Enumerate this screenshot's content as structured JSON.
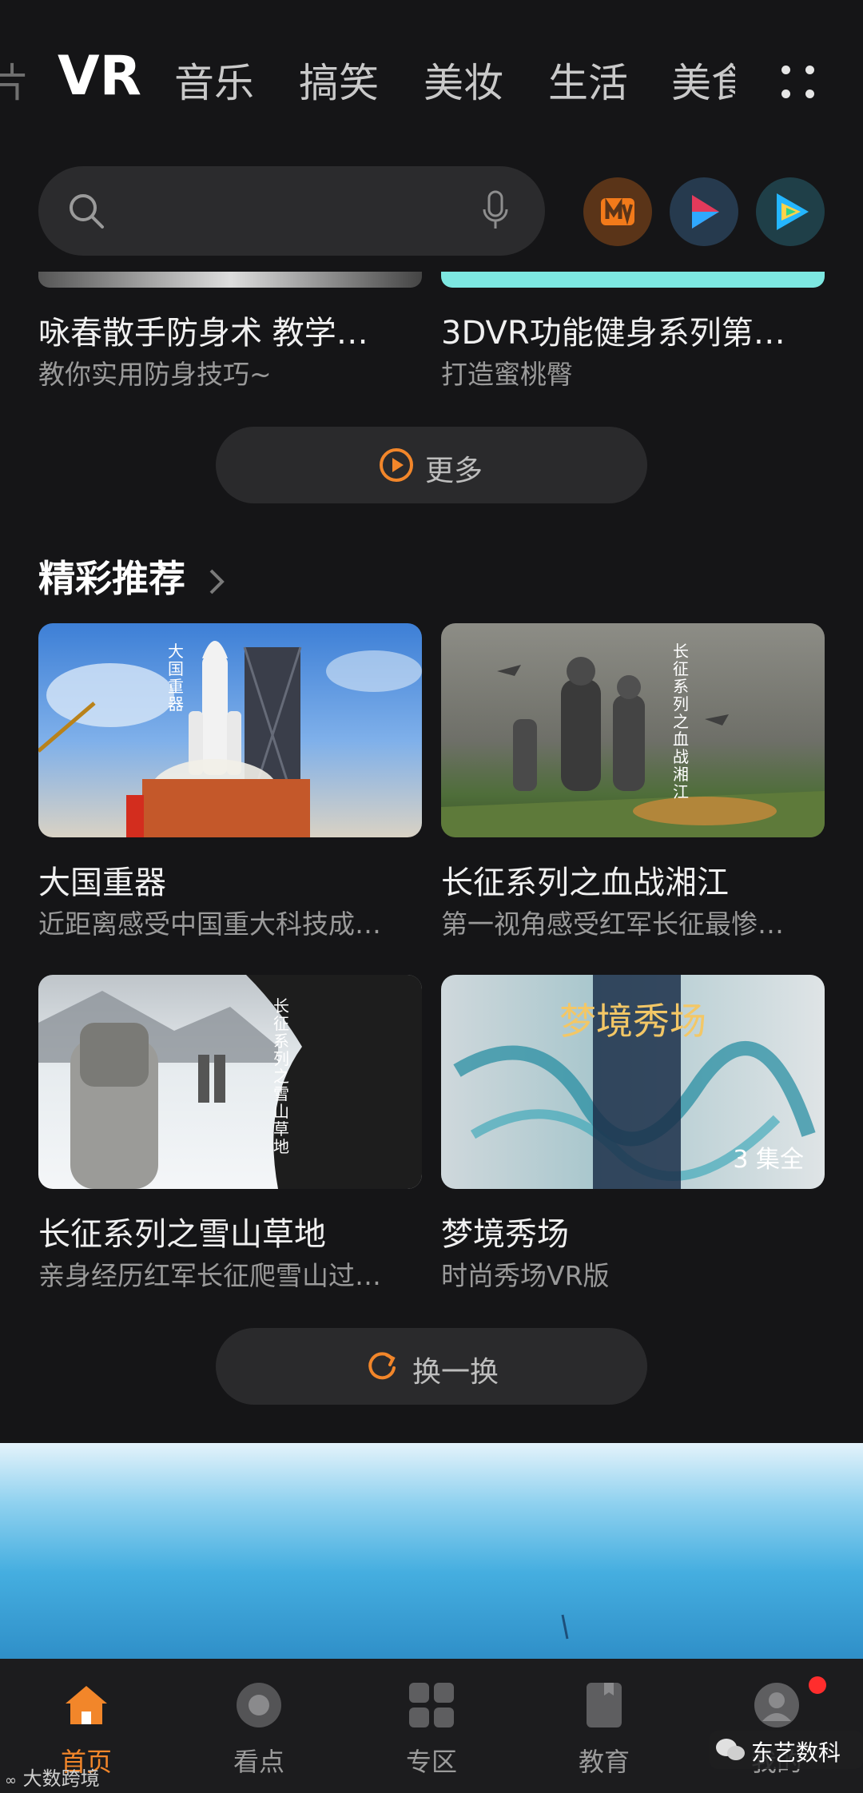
{
  "tabs": {
    "items": [
      "VR",
      "音乐",
      "搞笑",
      "美妆",
      "生活",
      "美食"
    ],
    "active": "VR",
    "left_partial": "片"
  },
  "search": {
    "placeholder": ""
  },
  "apps": [
    {
      "name": "mango-tv-icon",
      "color": "#f27a1a"
    },
    {
      "name": "video-play-icon",
      "color": "#e33a5b"
    },
    {
      "name": "tencent-video-icon",
      "color": "#2fc8ff"
    }
  ],
  "top_cards": [
    {
      "title": "咏春散手防身术 教学…",
      "subtitle": "教你实用防身技巧~"
    },
    {
      "title": "3DVR功能健身系列第…",
      "subtitle": "打造蜜桃臀"
    }
  ],
  "more_button": {
    "label": "更多"
  },
  "section": {
    "title": "精彩推荐"
  },
  "cards": [
    {
      "title": "大国重器",
      "subtitle": "近距离感受中国重大科技成…",
      "overlay_text": "大国重器"
    },
    {
      "title": "长征系列之血战湘江",
      "subtitle": "第一视角感受红军长征最惨…",
      "overlay_text": "长征系列之血战湘江"
    },
    {
      "title": "长征系列之雪山草地",
      "subtitle": "亲身经历红军长征爬雪山过…",
      "overlay_text": "长征系列之雪山草地"
    },
    {
      "title": "梦境秀场",
      "subtitle": "时尚秀场VR版",
      "overlay_text": "梦境秀场",
      "badge": "3 集全"
    }
  ],
  "refresh_button": {
    "label": "换一换"
  },
  "nav": {
    "items": [
      {
        "label": "首页",
        "icon": "home-icon",
        "active": true
      },
      {
        "label": "看点",
        "icon": "highlights-icon"
      },
      {
        "label": "专区",
        "icon": "grid-icon"
      },
      {
        "label": "教育",
        "icon": "book-icon"
      },
      {
        "label": "我的",
        "icon": "profile-icon",
        "has_dot": true
      }
    ]
  },
  "watermarks": {
    "left": "大数跨境",
    "right": "东艺数科"
  },
  "colors": {
    "accent": "#f2862a",
    "background": "#151517"
  }
}
